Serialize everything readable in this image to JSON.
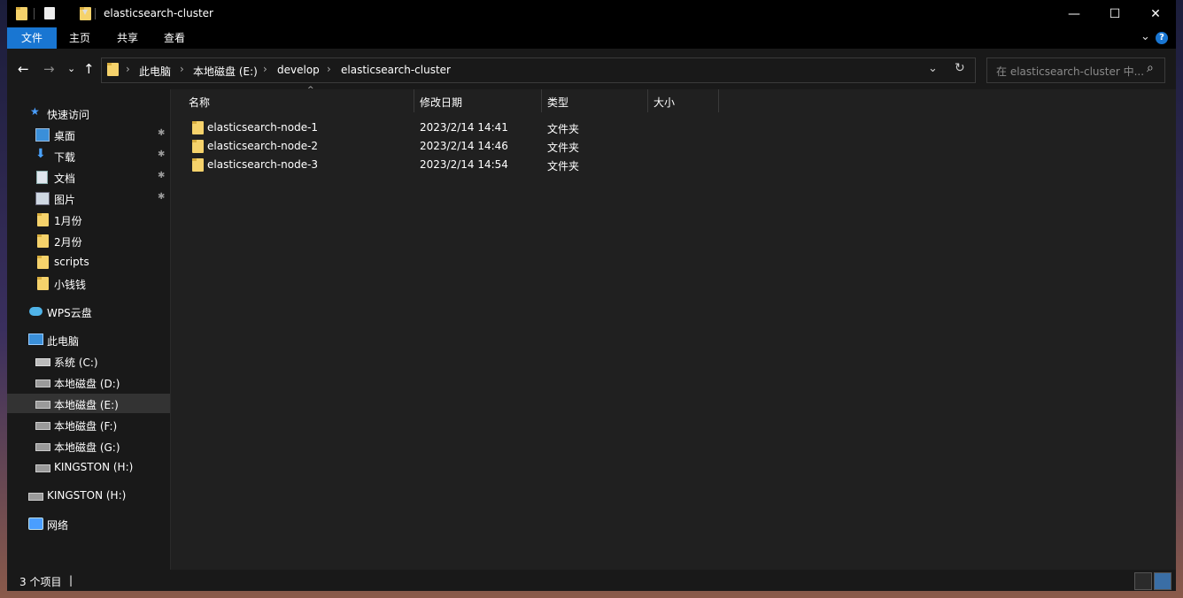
{
  "window": {
    "title": "elasticsearch-cluster"
  },
  "titlebar": {
    "minimize": "—",
    "maximize": "☐",
    "close": "✕",
    "qa_dropdown": "▾"
  },
  "ribbon": {
    "tabs": [
      {
        "label": "文件"
      },
      {
        "label": "主页"
      },
      {
        "label": "共享"
      },
      {
        "label": "查看"
      }
    ],
    "expand": "⌄",
    "help": "?"
  },
  "nav": {
    "back": "←",
    "forward": "→",
    "recent": "⌄",
    "up": "↑",
    "breadcrumb": [
      "此电脑",
      "本地磁盘 (E:)",
      "develop",
      "elasticsearch-cluster"
    ],
    "sep": "›",
    "dropdown": "⌄",
    "refresh": "↻",
    "search_placeholder": "在 elasticsearch-cluster 中...",
    "search_icon": "⌕"
  },
  "sidebar": {
    "quick_access": "快速访问",
    "pinned": [
      {
        "label": "桌面",
        "icon": "desktop-icon"
      },
      {
        "label": "下载",
        "icon": "download-icon"
      },
      {
        "label": "文档",
        "icon": "document-icon"
      },
      {
        "label": "图片",
        "icon": "pictures-icon"
      }
    ],
    "folders": [
      "1月份",
      "2月份",
      "scripts",
      "小钱钱"
    ],
    "wps": "WPS云盘",
    "this_pc": "此电脑",
    "drives": [
      "系统 (C:)",
      "本地磁盘 (D:)",
      "本地磁盘 (E:)",
      "本地磁盘 (F:)",
      "本地磁盘 (G:)",
      "KINGSTON (H:)"
    ],
    "usb": "KINGSTON (H:)",
    "network": "网络",
    "pin_glyph": "📌"
  },
  "columns": {
    "name": "名称",
    "date": "修改日期",
    "type": "类型",
    "size": "大小",
    "sort_caret": "^"
  },
  "files": [
    {
      "name": "elasticsearch-node-1",
      "date": "2023/2/14 14:41",
      "type": "文件夹"
    },
    {
      "name": "elasticsearch-node-2",
      "date": "2023/2/14 14:46",
      "type": "文件夹"
    },
    {
      "name": "elasticsearch-node-3",
      "date": "2023/2/14 14:54",
      "type": "文件夹"
    }
  ],
  "status": {
    "count": "3 个项目",
    "cursor": "|"
  },
  "colors": {
    "accent": "#1976d2",
    "folder": "#f5d26b",
    "background": "#191919",
    "list_bg": "#202020"
  }
}
